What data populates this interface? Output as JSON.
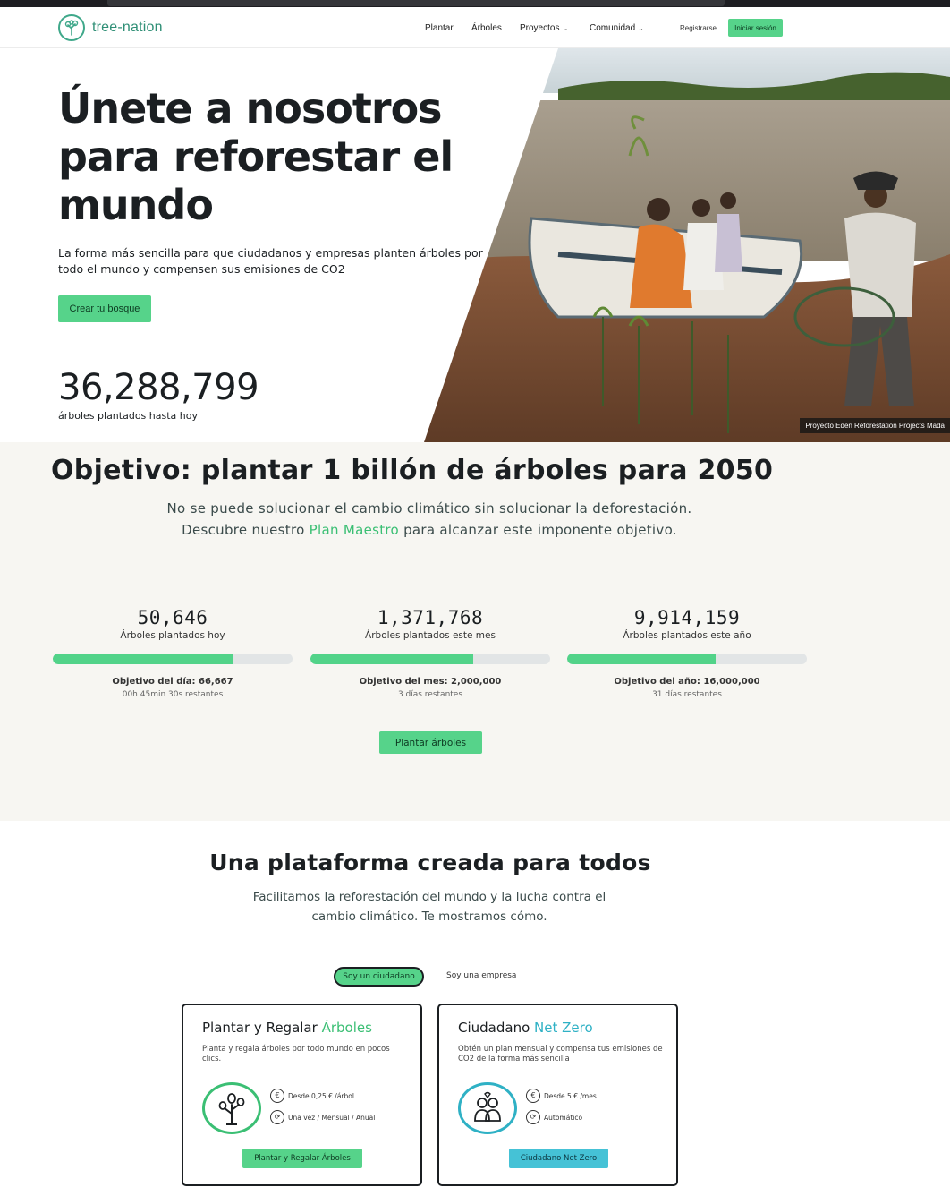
{
  "nav": {
    "logo_text": "tree-nation",
    "links": [
      "Plantar",
      "Árboles",
      "Proyectos",
      "Comunidad"
    ],
    "register": "Registrarse",
    "login": "Iniciar sesión"
  },
  "hero": {
    "title": "Únete a nosotros para reforestar el mundo",
    "subtitle": "La forma más sencilla para que ciudadanos y empresas planten árboles por todo el mundo y compensen sus emisiones de CO2",
    "cta": "Crear tu bosque",
    "counter": "36,288,799",
    "counter_label": "árboles plantados hasta hoy",
    "photo_caption": "Proyecto Eden Reforestation Projects Mada"
  },
  "goal": {
    "title": "Objetivo: plantar 1 billón de árboles para 2050",
    "text_before": "No se puede solucionar el cambio climático sin solucionar la deforestación. Descubre nuestro ",
    "text_link": "Plan Maestro",
    "text_after": " para alcanzar este imponente objetivo.",
    "stats": [
      {
        "value": "50,646",
        "label": "Árboles plantados hoy",
        "progress": 0.75,
        "target": "Objetivo del día: 66,667",
        "remaining": "00h 45min 30s restantes"
      },
      {
        "value": "1,371,768",
        "label": "Árboles plantados este mes",
        "progress": 0.68,
        "target": "Objetivo del mes: 2,000,000",
        "remaining": "3 días restantes"
      },
      {
        "value": "9,914,159",
        "label": "Árboles plantados este año",
        "progress": 0.62,
        "target": "Objetivo del año: 16,000,000",
        "remaining": "31 días restantes"
      }
    ],
    "cta": "Plantar árboles"
  },
  "platform": {
    "title": "Una plataforma creada para todos",
    "text": "Facilitamos la reforestación del mundo y la lucha contra el cambio climático. Te mostramos cómo.",
    "toggle_citizen": "Soy un ciudadano",
    "toggle_company": "Soy una empresa",
    "cards": [
      {
        "title_prefix": "Plantar y Regalar ",
        "title_accent": "Árboles",
        "desc": "Planta y regala árboles por todo mundo en pocos clics.",
        "feature_1": "Desde 0,25 € /árbol",
        "feature_2": "Una vez / Mensual / Anual",
        "button": "Plantar y Regalar Árboles",
        "icon": "tree-sprout-icon",
        "accent_color": "#3bbf74"
      },
      {
        "title_prefix": "Ciudadano ",
        "title_accent": "Net Zero",
        "desc": "Obtén un plan mensual y compensa tus emisiones de CO2 de la forma más sencilla",
        "feature_1": "Desde 5 € /mes",
        "feature_2": "Automático",
        "button": "Ciudadano Net Zero",
        "icon": "people-group-icon",
        "accent_color": "#2fb1c5"
      }
    ]
  },
  "colors": {
    "brand_green": "#56d38a",
    "accent_green": "#3bbf74",
    "accent_blue": "#2fb1c5",
    "logo_teal": "#2f8f76"
  }
}
